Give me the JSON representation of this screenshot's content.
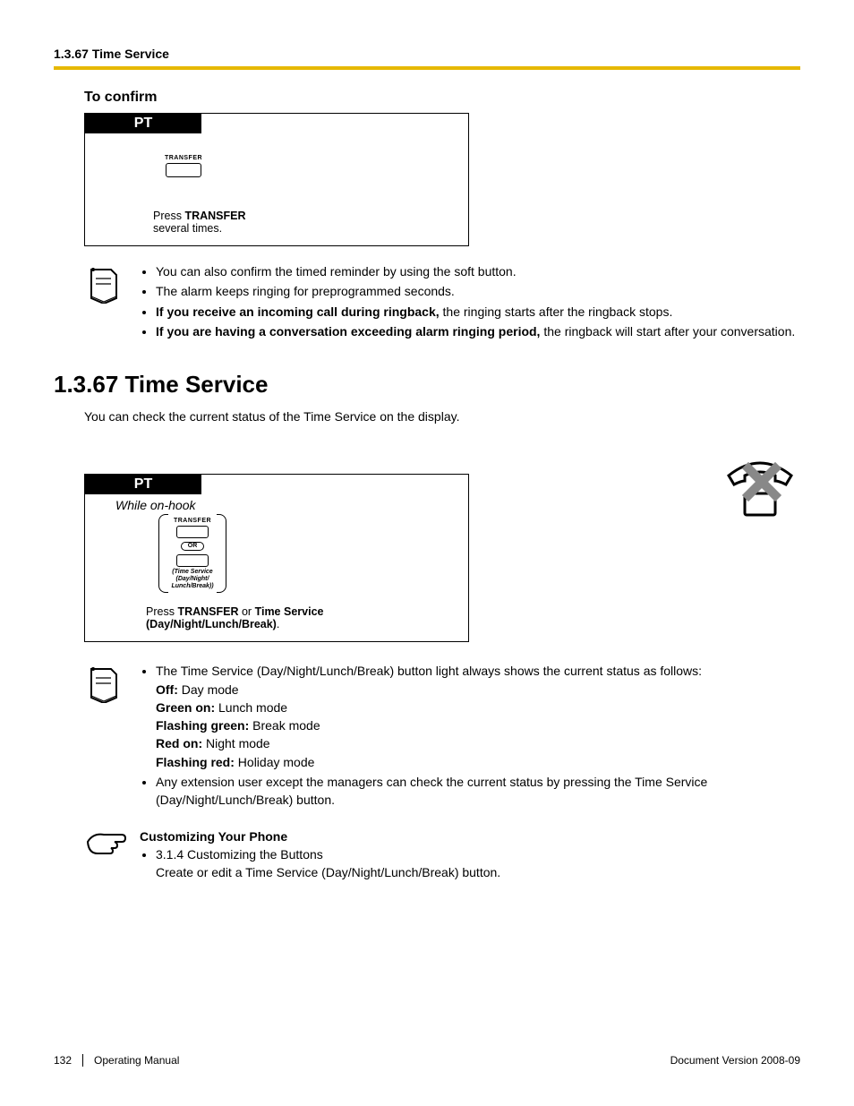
{
  "running_head": "1.3.67 Time Service",
  "subhead_confirm": "To confirm",
  "pt_label": "PT",
  "transfer_label": "TRANSFER",
  "confirm_caption_prefix": "Press ",
  "confirm_caption_bold": "TRANSFER",
  "confirm_caption_suffix": "several times.",
  "notes1": {
    "b1": "You can also confirm the timed reminder by using the soft button.",
    "b2": "The alarm keeps ringing for preprogrammed seconds.",
    "b3_bold": "If you receive an incoming call during ringback,",
    "b3_rest": " the ringing starts after the ringback stops.",
    "b4_bold": "If you are having a conversation exceeding alarm ringing period,",
    "b4_rest": " the ringback will start after your conversation."
  },
  "h2_num": "1.3.67",
  "h2_title": "  Time Service",
  "intro": "You can check the current status of the Time Service on the display.",
  "while_on_hook": "While on-hook",
  "or_label": "OR",
  "ts_tiny_1": "(Time Service",
  "ts_tiny_2": "(Day/Night/",
  "ts_tiny_3": "Lunch/Break))",
  "caption2_p1": "Press ",
  "caption2_b1": "TRANSFER",
  "caption2_p2": " or ",
  "caption2_b2": "Time Service",
  "caption2_line2": "(Day/Night/Lunch/Break)",
  "caption2_dot": ".",
  "notes2": {
    "b1": "The Time Service (Day/Night/Lunch/Break) button light always shows the current status as follows:",
    "off_b": "Off:",
    "off_t": " Day mode",
    "grn_b": "Green on:",
    "grn_t": " Lunch mode",
    "fg_b": "Flashing green:",
    "fg_t": " Break mode",
    "red_b": "Red on:",
    "red_t": " Night mode",
    "fr_b": "Flashing red:",
    "fr_t": " Holiday mode",
    "b2": "Any extension user except the managers can check the current status by pressing the Time Service (Day/Night/Lunch/Break) button."
  },
  "cust": {
    "title": "Customizing Your Phone",
    "b1_num": "3.1.4  Customizing the Buttons",
    "b1_txt": "Create or edit a Time Service (Day/Night/Lunch/Break) button."
  },
  "footer": {
    "page": "132",
    "manual": "Operating Manual",
    "docver": "Document Version  2008-09"
  }
}
